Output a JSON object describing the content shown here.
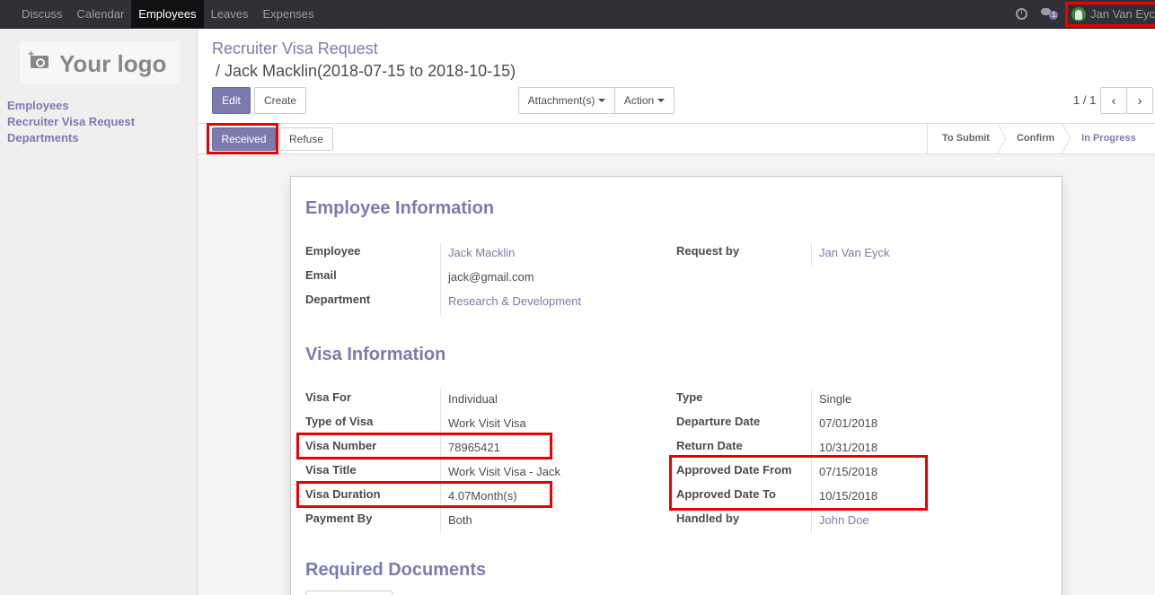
{
  "topbar": {
    "menu": [
      "Discuss",
      "Calendar",
      "Employees",
      "Leaves",
      "Expenses"
    ],
    "active": "Employees",
    "chat_count": "1",
    "user_name": "Jan Van Eyck"
  },
  "sidebar": {
    "logo_text": "Your logo",
    "items": [
      "Employees",
      "Recruiter Visa Request",
      "Departments"
    ]
  },
  "control": {
    "breadcrumb_parent": "Recruiter Visa Request",
    "breadcrumb_current": "/  Jack Macklin(2018-07-15 to 2018-10-15)",
    "edit_label": "Edit",
    "create_label": "Create",
    "attachments_label": "Attachment(s)",
    "action_label": "Action",
    "pager": "1 / 1"
  },
  "statusbar": {
    "received_label": "Received",
    "refuse_label": "Refuse",
    "stages": [
      "To Submit",
      "Confirm",
      "In Progress"
    ],
    "current_stage": "In Progress"
  },
  "form": {
    "employee_section": {
      "title": "Employee Information",
      "employee_label": "Employee",
      "employee_value": "Jack Macklin",
      "email_label": "Email",
      "email_value": "jack@gmail.com",
      "department_label": "Department",
      "department_value": "Research & Development",
      "request_by_label": "Request by",
      "request_by_value": "Jan Van Eyck"
    },
    "visa_section": {
      "title": "Visa Information",
      "left": [
        {
          "label": "Visa For",
          "value": "Individual"
        },
        {
          "label": "Type of Visa",
          "value": "Work Visit Visa"
        },
        {
          "label": "Visa Number",
          "value": "78965421"
        },
        {
          "label": "Visa Title",
          "value": "Work Visit Visa - Jack"
        },
        {
          "label": "Visa Duration",
          "value": "4.07Month(s)"
        },
        {
          "label": "Payment By",
          "value": "Both"
        }
      ],
      "right": [
        {
          "label": "Type",
          "value": "Single"
        },
        {
          "label": "Departure Date",
          "value": "07/01/2018"
        },
        {
          "label": "Return Date",
          "value": "10/31/2018"
        },
        {
          "label": "Approved Date From",
          "value": "07/15/2018"
        },
        {
          "label": "Approved Date To",
          "value": "10/15/2018"
        },
        {
          "label": "Handled by",
          "value": "John Doe"
        }
      ]
    },
    "documents_section": {
      "title": "Required Documents"
    }
  },
  "colors": {
    "brand": "#7c7bad",
    "navbar": "#2f3136",
    "highlight": "#e00000"
  }
}
